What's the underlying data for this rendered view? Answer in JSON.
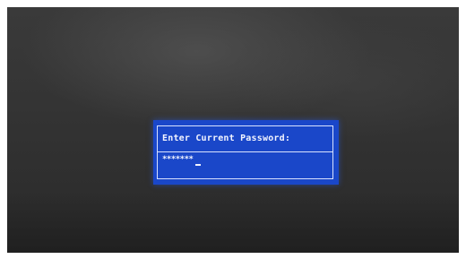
{
  "bios_password_prompt": {
    "prompt_label": "Enter Current Password:",
    "password_mask": "*******",
    "colors": {
      "dialog_background": "#1a47c9",
      "dialog_border": "#d9e2ff",
      "text": "#f2f4ff",
      "screen_background": "#333333"
    }
  }
}
